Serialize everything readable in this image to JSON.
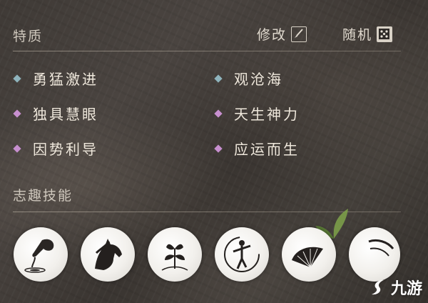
{
  "traits_section": {
    "title": "特质",
    "edit_label": "修改",
    "random_label": "随机",
    "edit_icon": "brush-icon",
    "random_icon": "dice-icon"
  },
  "traits": [
    {
      "label": "勇猛激进",
      "tier_color": "#8fb4bd"
    },
    {
      "label": "观沧海",
      "tier_color": "#8fb4bd"
    },
    {
      "label": "独具慧眼",
      "tier_color": "#c78fcf"
    },
    {
      "label": "天生神力",
      "tier_color": "#c78fcf"
    },
    {
      "label": "因势利导",
      "tier_color": "#c78fcf"
    },
    {
      "label": "应运而生",
      "tier_color": "#c78fcf"
    }
  ],
  "skills_section": {
    "title": "志趣技能"
  },
  "skills": [
    {
      "icon": "water-pour-icon"
    },
    {
      "icon": "horse-icon"
    },
    {
      "icon": "herb-icon"
    },
    {
      "icon": "martial-arts-icon"
    },
    {
      "icon": "fan-icon"
    },
    {
      "icon": "partial-skill-icon"
    }
  ],
  "watermark": {
    "text": "九游",
    "icon": "jiuyou-logo-icon"
  }
}
